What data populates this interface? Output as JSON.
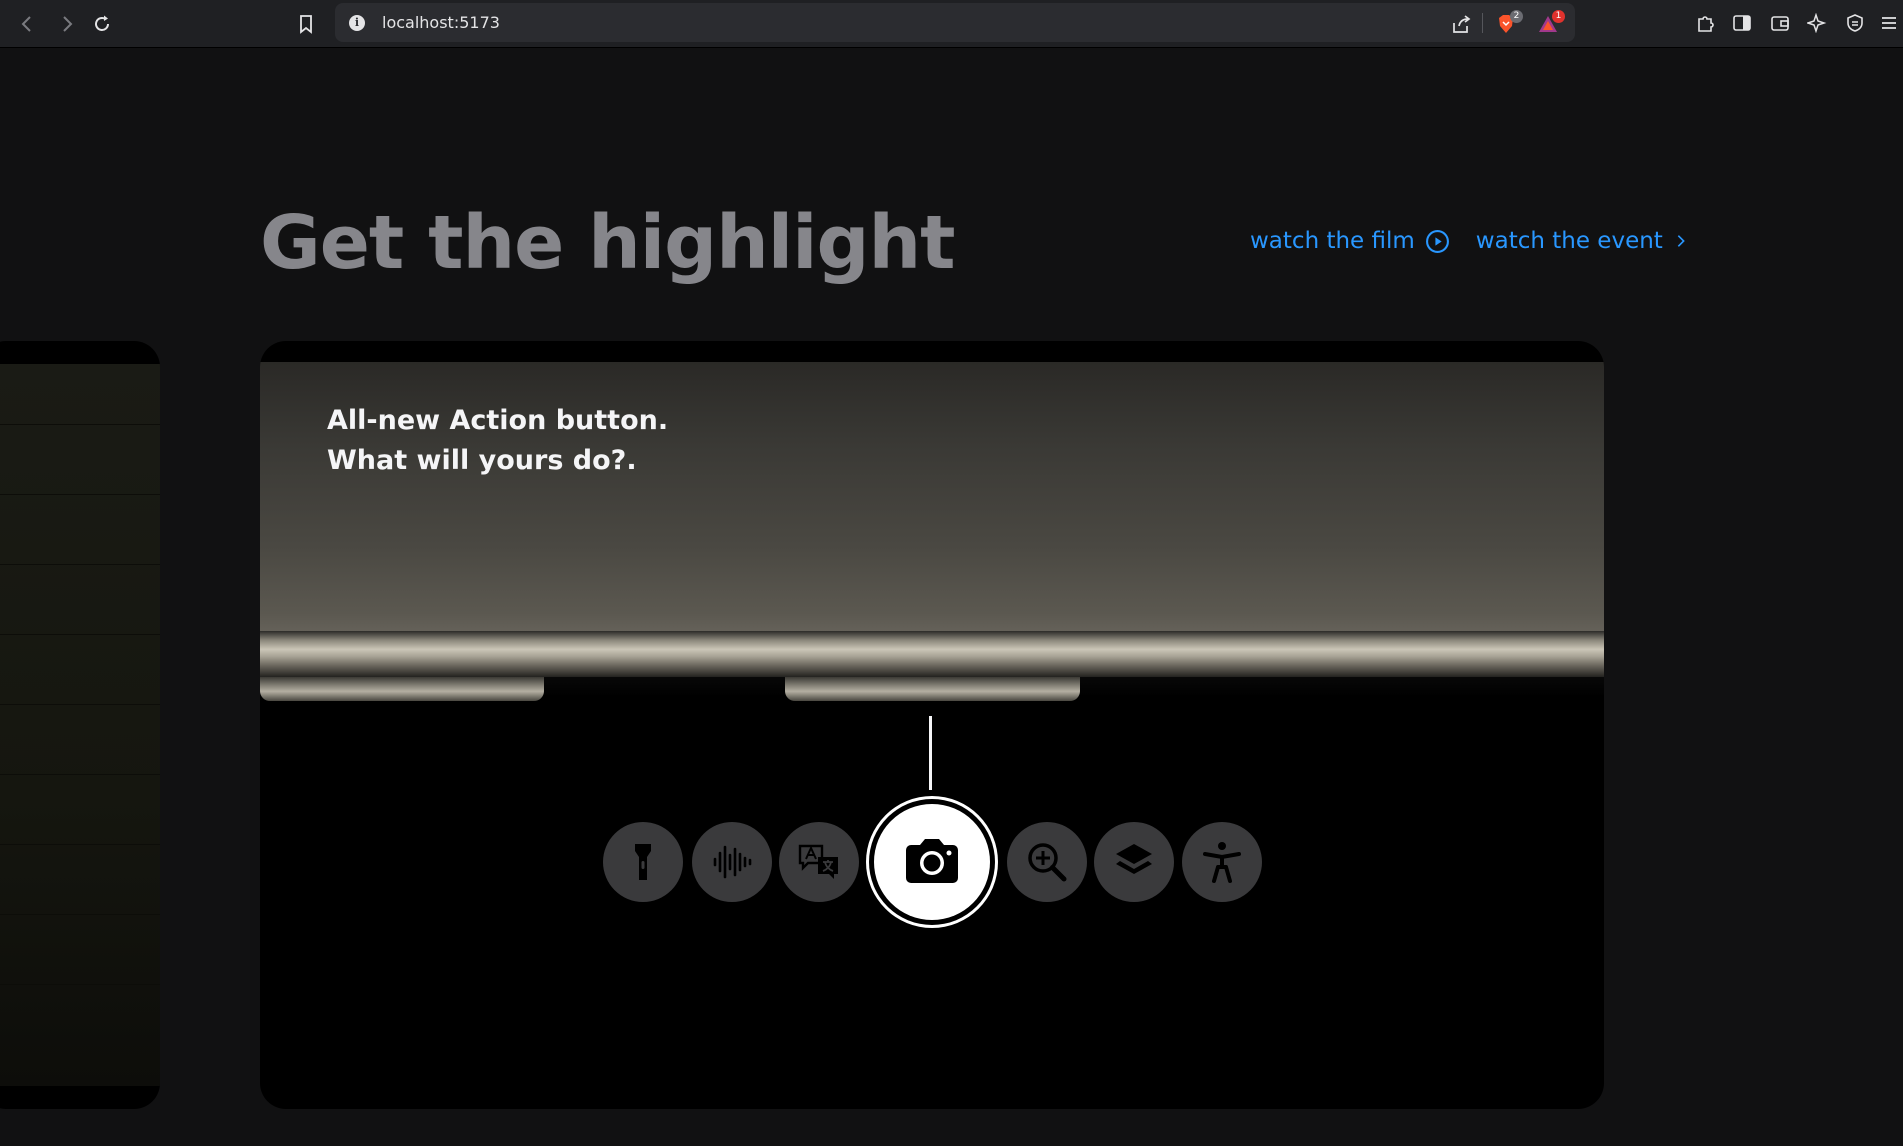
{
  "browser": {
    "url": "localhost:5173",
    "brave_badge_count": "2",
    "rewards_badge_count": "1"
  },
  "page": {
    "heading": "Get the highlight",
    "links": [
      {
        "label": "watch the film",
        "icon": "play-circle-icon"
      },
      {
        "label": "watch the event",
        "icon": "chevron-right-icon"
      }
    ]
  },
  "highlight_card": {
    "caption_line1": "All-new Action button.",
    "caption_line2": "What will yours do?.",
    "action_icons": [
      "flashlight-icon",
      "voice-memo-icon",
      "translate-icon",
      "camera-icon",
      "magnifier-icon",
      "shortcuts-icon",
      "accessibility-icon"
    ],
    "selected_action": "camera-icon"
  },
  "colors": {
    "background": "#111112",
    "link": "#2997ff",
    "heading": "#86868b",
    "icon_bg": "#3a3a3c"
  }
}
